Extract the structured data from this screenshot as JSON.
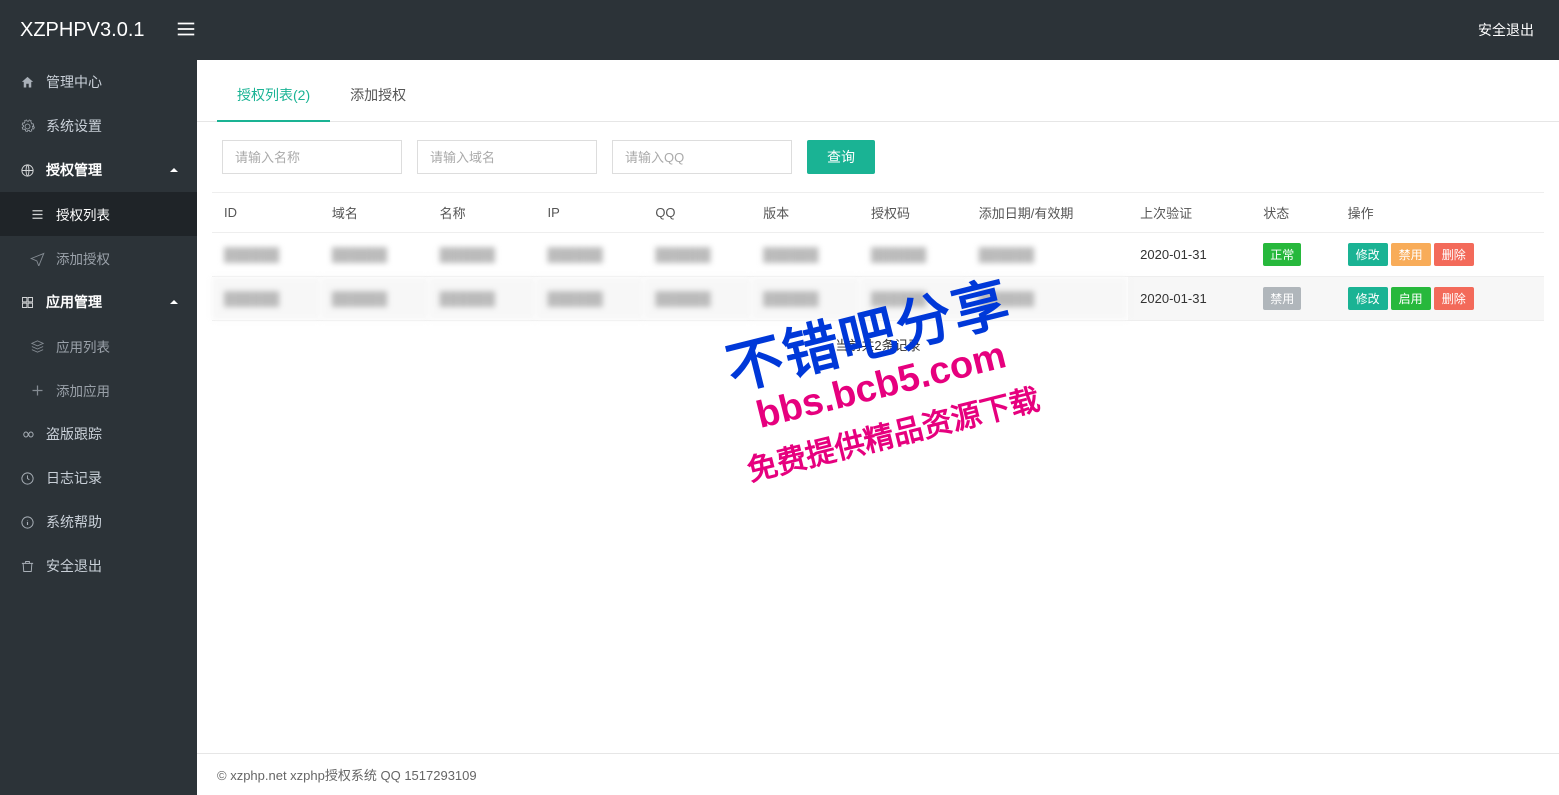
{
  "header": {
    "brand": "XZPHPV3.0.1",
    "logout": "安全退出"
  },
  "sidebar": {
    "dashboard": "管理中心",
    "settings": "系统设置",
    "auth_mgmt": "授权管理",
    "auth_list": "授权列表",
    "add_auth": "添加授权",
    "app_mgmt": "应用管理",
    "app_list": "应用列表",
    "add_app": "添加应用",
    "piracy": "盗版跟踪",
    "logs": "日志记录",
    "help": "系统帮助",
    "exit": "安全退出"
  },
  "tabs": {
    "list": "授权列表(2)",
    "add": "添加授权"
  },
  "search": {
    "name_ph": "请输入名称",
    "domain_ph": "请输入域名",
    "qq_ph": "请输入QQ",
    "query": "查询"
  },
  "table": {
    "headers": {
      "id": "ID",
      "domain": "域名",
      "name": "名称",
      "ip": "IP",
      "qq": "QQ",
      "version": "版本",
      "authcode": "授权码",
      "date": "添加日期/有效期",
      "last": "上次验证",
      "status": "状态",
      "action": "操作"
    },
    "rows": [
      {
        "last": "2020-01-31",
        "status": "正常",
        "status_cls": "ok",
        "btn2": "禁用",
        "btn2_cls": "orange"
      },
      {
        "last": "2020-01-31",
        "status": "禁用",
        "status_cls": "off",
        "btn2": "启用",
        "btn2_cls": "green"
      }
    ],
    "action_edit": "修改",
    "action_delete": "删除",
    "footer": "当前共2条记录"
  },
  "watermark": {
    "line1": "不错吧分享",
    "line2": "bbs.bcb5.com",
    "line3": "免费提供精品资源下载"
  },
  "footer": "© xzphp.net xzphp授权系统 QQ 1517293109"
}
